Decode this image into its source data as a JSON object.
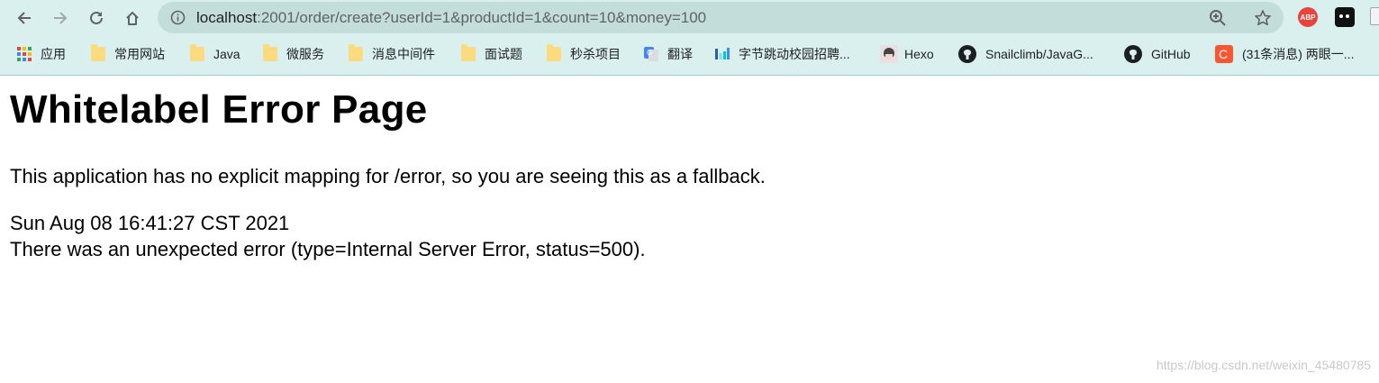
{
  "browser": {
    "url_host": "localhost",
    "url_rest": ":2001/order/create?userId=1&productId=1&count=10&money=100",
    "icons": [
      "back-icon",
      "forward-icon",
      "reload-icon",
      "home-icon",
      "info-icon",
      "zoom-icon",
      "star-icon"
    ],
    "extensions": [
      {
        "name": "adblock-plus-icon",
        "label": "ABP"
      },
      {
        "name": "extension-icon"
      },
      {
        "name": "extension-icon"
      }
    ],
    "bookmarks": [
      {
        "label": "应用",
        "icon": "apps-icon"
      },
      {
        "label": "常用网站",
        "icon": "folder-icon"
      },
      {
        "label": "Java",
        "icon": "folder-icon"
      },
      {
        "label": "微服务",
        "icon": "folder-icon"
      },
      {
        "label": "消息中间件",
        "icon": "folder-icon"
      },
      {
        "label": "面试题",
        "icon": "folder-icon"
      },
      {
        "label": "秒杀项目",
        "icon": "folder-icon"
      },
      {
        "label": "翻译",
        "icon": "google-translate-icon"
      },
      {
        "label": "字节跳动校园招聘...",
        "icon": "bytedance-icon"
      },
      {
        "label": "Hexo",
        "icon": "hexo-icon"
      },
      {
        "label": "Snailclimb/JavaG...",
        "icon": "github-icon"
      },
      {
        "label": "GitHub",
        "icon": "github-icon"
      },
      {
        "label": "(31条消息) 两眼一...",
        "icon": "csdn-icon"
      }
    ],
    "colors": {
      "chrome_bg": "#daf0ef",
      "omnibox_bg": "#c3dddb"
    }
  },
  "page": {
    "title": "Whitelabel Error Page",
    "message": "This application has no explicit mapping for /error, so you are seeing this as a fallback.",
    "timestamp": "Sun Aug 08 16:41:27 CST 2021",
    "error": "There was an unexpected error (type=Internal Server Error, status=500).",
    "watermark": "https://blog.csdn.net/weixin_45480785"
  }
}
